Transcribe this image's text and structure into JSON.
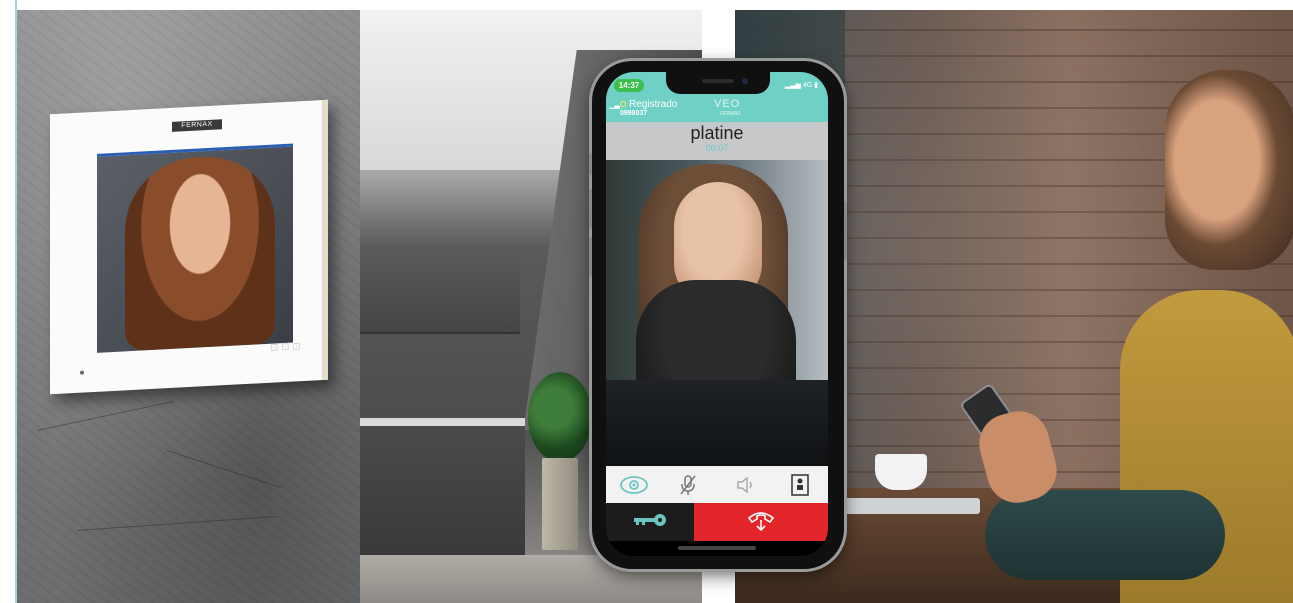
{
  "monitor": {
    "brand": "FERNAX",
    "icons": "⊡ ⊡ ⊡"
  },
  "app": {
    "status_time": "14:37",
    "status_network": "4G",
    "registration_status": "Registrado",
    "registration_number": "0999037",
    "logo": "VEO",
    "logo_sub": "FERMAX",
    "caller_name": "platine",
    "call_duration": "00:07"
  },
  "controls": [
    {
      "name": "eye-icon",
      "label": ""
    },
    {
      "name": "microphone-muted-icon",
      "label": ""
    },
    {
      "name": "speaker-icon",
      "label": ""
    },
    {
      "name": "door-panel-icon",
      "label": ""
    }
  ],
  "colors": {
    "header": "#6fd0c6",
    "time_pill": "#3bbf4d",
    "hangup": "#e3262a",
    "open_door": "#1c1c1c",
    "accent": "#6cc6c0"
  }
}
